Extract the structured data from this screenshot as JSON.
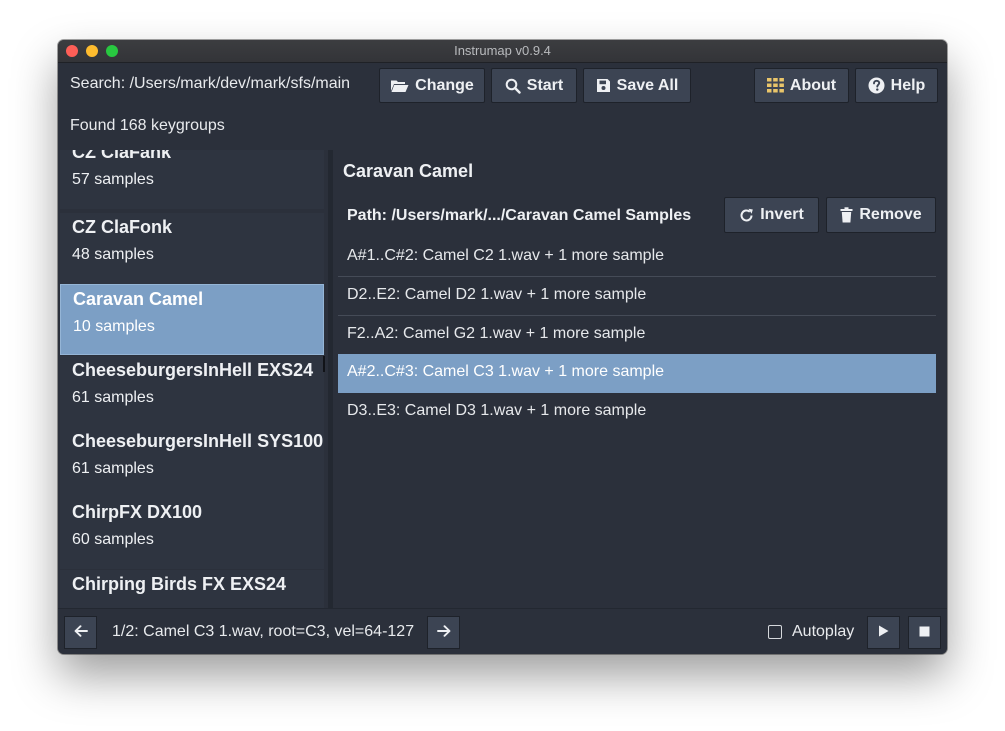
{
  "window": {
    "title": "Instrumap v0.9.4"
  },
  "toolbar": {
    "search_label": "Search: /Users/mark/dev/mark/sfs/main",
    "change_label": "Change",
    "start_label": "Start",
    "save_all_label": "Save All",
    "about_label": "About",
    "help_label": "Help"
  },
  "status": {
    "found_text": "Found 168 keygroups"
  },
  "keygroups": [
    {
      "name": "CZ ClaFank",
      "count": "57 samples"
    },
    {
      "name": "CZ ClaFonk",
      "count": "48 samples"
    },
    {
      "name": "Caravan Camel",
      "count": "10 samples"
    },
    {
      "name": "CheeseburgersInHell EXS24",
      "count": "61 samples"
    },
    {
      "name": "CheeseburgersInHell SYS100",
      "count": "61 samples"
    },
    {
      "name": "ChirpFX DX100",
      "count": "60 samples"
    },
    {
      "name": "Chirping Birds FX EXS24",
      "count": ""
    }
  ],
  "selected_keygroup_index": 2,
  "detail": {
    "title": "Caravan Camel",
    "path": "Path: /Users/mark/.../Caravan Camel Samples",
    "invert_label": "Invert",
    "remove_label": "Remove",
    "samples": [
      "A#1..C#2: Camel C2 1.wav + 1 more sample",
      "D2..E2: Camel D2 1.wav + 1 more sample",
      "F2..A2: Camel G2 1.wav + 1 more sample",
      "A#2..C#3: Camel C3 1.wav + 1 more sample",
      "D3..E3: Camel D3 1.wav + 1 more sample"
    ],
    "selected_sample_index": 3
  },
  "footer": {
    "current_sample": "1/2: Camel C3 1.wav, root=C3, vel=64-127",
    "autoplay_label": "Autoplay",
    "autoplay_checked": false
  },
  "icons": {
    "change": "folder-open-icon",
    "start": "search-icon",
    "save_all": "save-icon",
    "about": "grid-icon",
    "help": "help-circle-icon",
    "invert": "refresh-icon",
    "remove": "trash-icon",
    "prev": "arrow-left-icon",
    "next": "arrow-right-icon",
    "play": "play-icon",
    "stop": "stop-icon"
  },
  "colors": {
    "background": "#2b303b",
    "selection": "#7c9fc5",
    "button": "#3c4453",
    "list_item": "#2e3440"
  }
}
